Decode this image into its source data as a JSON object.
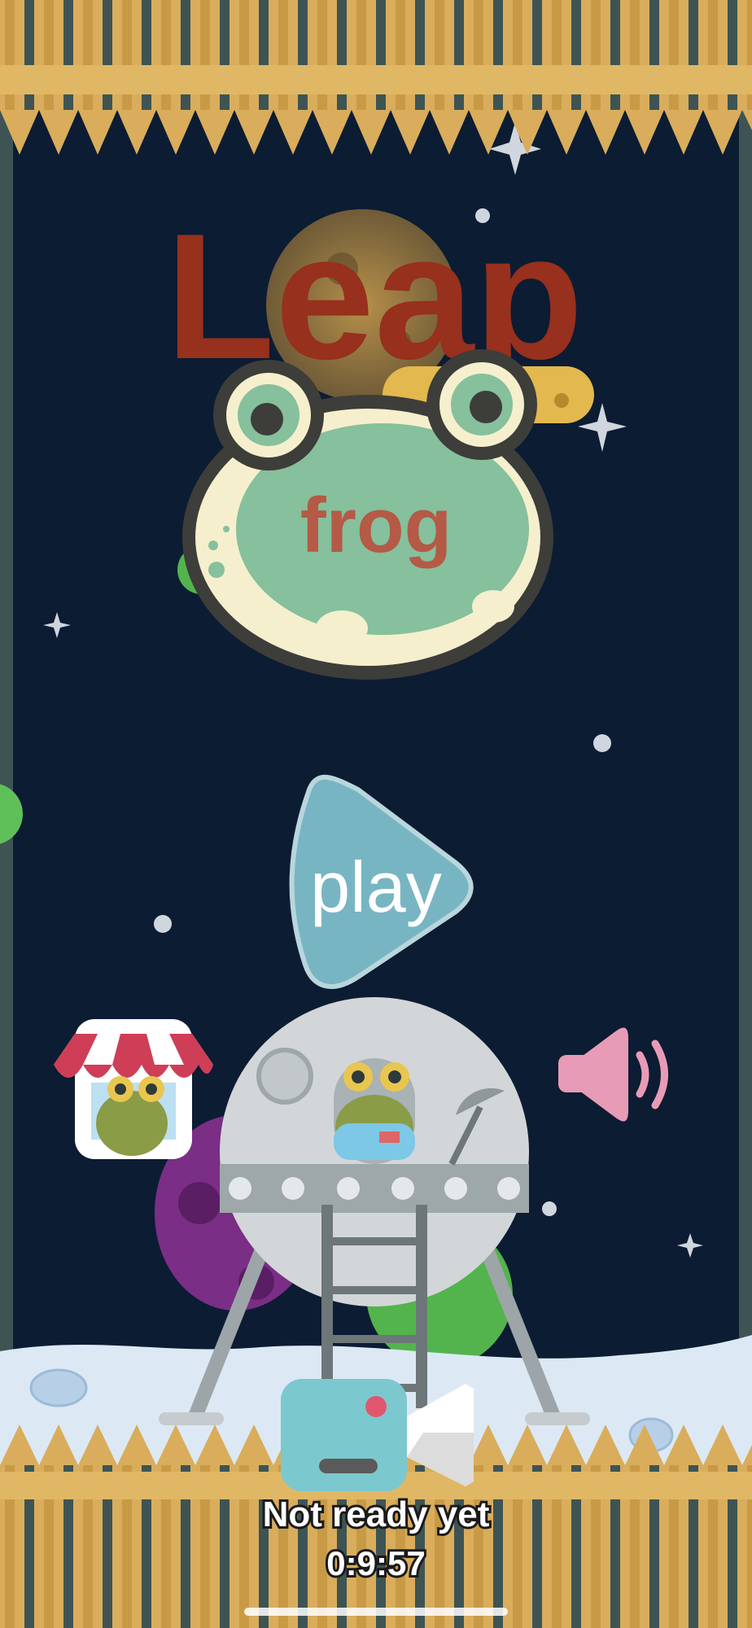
{
  "title": {
    "word1": "Leap",
    "word2": "frog"
  },
  "buttons": {
    "play_label": "play",
    "shop": "shop-frog-icon",
    "sound": "speaker-icon",
    "video": "video-camera-icon"
  },
  "reward_video": {
    "status": "Not ready yet",
    "countdown": "0:9:57"
  },
  "colors": {
    "background": "#0c1c33",
    "fence_plank": "#d9ad5c",
    "fence_dark": "#3e5454",
    "title_red": "#97301d",
    "frog_green": "#86c09c",
    "play_button": "#78b5c3",
    "speaker_pink": "#e89bb6",
    "camera_blue": "#7cc8cf"
  }
}
